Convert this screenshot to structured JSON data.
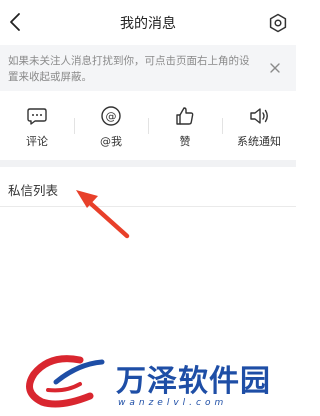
{
  "header": {
    "title": "我的消息",
    "back_icon": "chevron-left-icon",
    "settings_icon": "gear-icon"
  },
  "notice": {
    "text": "如果未关注人消息打扰到你，可点击页面右上角的设置来收起或屏蔽。",
    "close_icon": "close-icon"
  },
  "tabs": [
    {
      "label": "评论",
      "icon": "comment-bubble-icon"
    },
    {
      "label": "@我",
      "icon": "at-sign-icon"
    },
    {
      "label": "赞",
      "icon": "thumbs-up-icon"
    },
    {
      "label": "系统通知",
      "icon": "speaker-icon"
    }
  ],
  "section": {
    "title": "私信列表"
  },
  "annotation": {
    "arrow_color": "#e8402a"
  },
  "watermark": {
    "text": "万泽软件园",
    "url": "wanzelvl.com",
    "logo_icon": "wanze-logo-icon",
    "color": "#1e4ea6"
  }
}
